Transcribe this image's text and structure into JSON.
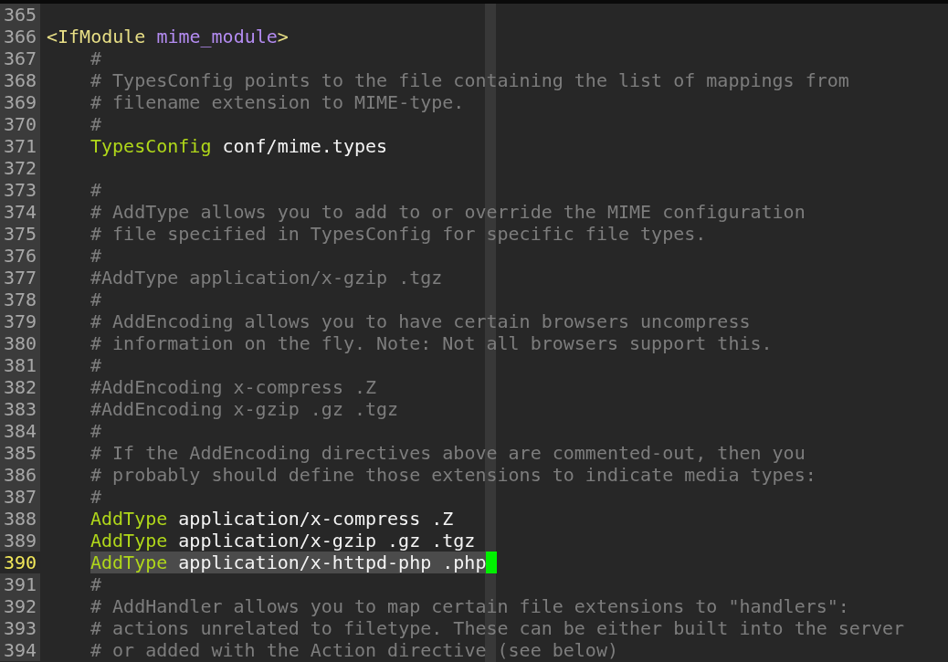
{
  "editor": {
    "lines": [
      {
        "number": "365",
        "current": false
      },
      {
        "number": "366",
        "current": false,
        "tokens": [
          {
            "kind": "tag",
            "text": "<IfModule"
          },
          {
            "kind": "attr",
            "text": "mime_module"
          },
          {
            "kind": "close",
            "text": ">"
          }
        ],
        "children": [
          {
            "number": "367",
            "current": false,
            "tokens": [
              {
                "kind": "comment",
                "text": "#"
              }
            ]
          },
          {
            "number": "368",
            "current": false,
            "tokens": [
              {
                "kind": "comment",
                "text": "# TypesConfig points to the file containing the list of mappings from"
              }
            ]
          },
          {
            "number": "369",
            "current": false,
            "tokens": [
              {
                "kind": "comment",
                "text": "# filename extension to MIME-type."
              }
            ]
          },
          {
            "number": "370",
            "current": false,
            "tokens": [
              {
                "kind": "comment",
                "text": "#"
              }
            ]
          },
          {
            "number": "371",
            "current": false,
            "tokens": [
              {
                "kind": "keyword",
                "text": "TypesConfig"
              },
              {
                "kind": "value",
                "text": "conf/mime.types"
              }
            ]
          },
          {
            "number": "372",
            "current": false
          },
          {
            "number": "373",
            "current": false,
            "tokens": [
              {
                "kind": "comment",
                "text": "#"
              }
            ]
          },
          {
            "number": "374",
            "current": false,
            "tokens": [
              {
                "kind": "comment",
                "text": "# AddType allows you to add to or override the MIME configuration"
              }
            ]
          },
          {
            "number": "375",
            "current": false,
            "tokens": [
              {
                "kind": "comment",
                "text": "# file specified in TypesConfig for specific file types."
              }
            ]
          },
          {
            "number": "376",
            "current": false,
            "tokens": [
              {
                "kind": "comment",
                "text": "#"
              }
            ]
          },
          {
            "number": "377",
            "current": false,
            "tokens": [
              {
                "kind": "comment",
                "text": "#AddType application/x-gzip .tgz"
              }
            ]
          },
          {
            "number": "378",
            "current": false,
            "tokens": [
              {
                "kind": "comment",
                "text": "#"
              }
            ]
          },
          {
            "number": "379",
            "current": false,
            "tokens": [
              {
                "kind": "comment",
                "text": "# AddEncoding allows you to have certain browsers uncompress"
              }
            ]
          },
          {
            "number": "380",
            "current": false,
            "tokens": [
              {
                "kind": "comment",
                "text": "# information on the fly. Note: Not all browsers support this."
              }
            ]
          },
          {
            "number": "381",
            "current": false,
            "tokens": [
              {
                "kind": "comment",
                "text": "#"
              }
            ]
          },
          {
            "number": "382",
            "current": false,
            "tokens": [
              {
                "kind": "comment",
                "text": "#AddEncoding x-compress .Z"
              }
            ]
          },
          {
            "number": "383",
            "current": false,
            "tokens": [
              {
                "kind": "comment",
                "text": "#AddEncoding x-gzip .gz .tgz"
              }
            ]
          },
          {
            "number": "384",
            "current": false,
            "tokens": [
              {
                "kind": "comment",
                "text": "#"
              }
            ]
          },
          {
            "number": "385",
            "current": false,
            "tokens": [
              {
                "kind": "comment",
                "text": "# If the AddEncoding directives above are commented-out, then you"
              }
            ]
          },
          {
            "number": "386",
            "current": false,
            "tokens": [
              {
                "kind": "comment",
                "text": "# probably should define those extensions to indicate media types:"
              }
            ]
          },
          {
            "number": "387",
            "current": false,
            "tokens": [
              {
                "kind": "comment",
                "text": "#"
              }
            ]
          },
          {
            "number": "388",
            "current": false,
            "tokens": [
              {
                "kind": "keyword",
                "text": "AddType"
              },
              {
                "kind": "value",
                "text": "application/x-compress .Z"
              }
            ]
          },
          {
            "number": "389",
            "current": false,
            "tokens": [
              {
                "kind": "keyword",
                "text": "AddType"
              },
              {
                "kind": "value",
                "text": "application/x-gzip .gz .tgz"
              }
            ]
          },
          {
            "number": "390",
            "current": true,
            "tokens": [
              {
                "kind": "keyword",
                "text": "AddType"
              },
              {
                "kind": "value",
                "text": "application/x-httpd-php .php"
              }
            ]
          },
          {
            "number": "391",
            "current": false,
            "tokens": [
              {
                "kind": "comment",
                "text": "#"
              }
            ]
          },
          {
            "number": "392",
            "current": false,
            "tokens": [
              {
                "kind": "comment",
                "text": "# AddHandler allows you to map certain file extensions to \"handlers\":"
              }
            ]
          },
          {
            "number": "393",
            "current": false,
            "tokens": [
              {
                "kind": "comment",
                "text": "# actions unrelated to filetype. These can be either built into the server"
              }
            ]
          },
          {
            "number": "394",
            "current": false,
            "tokens": [
              {
                "kind": "comment",
                "text": "# or added with the Action directive (see below)"
              }
            ]
          }
        ]
      }
    ]
  }
}
